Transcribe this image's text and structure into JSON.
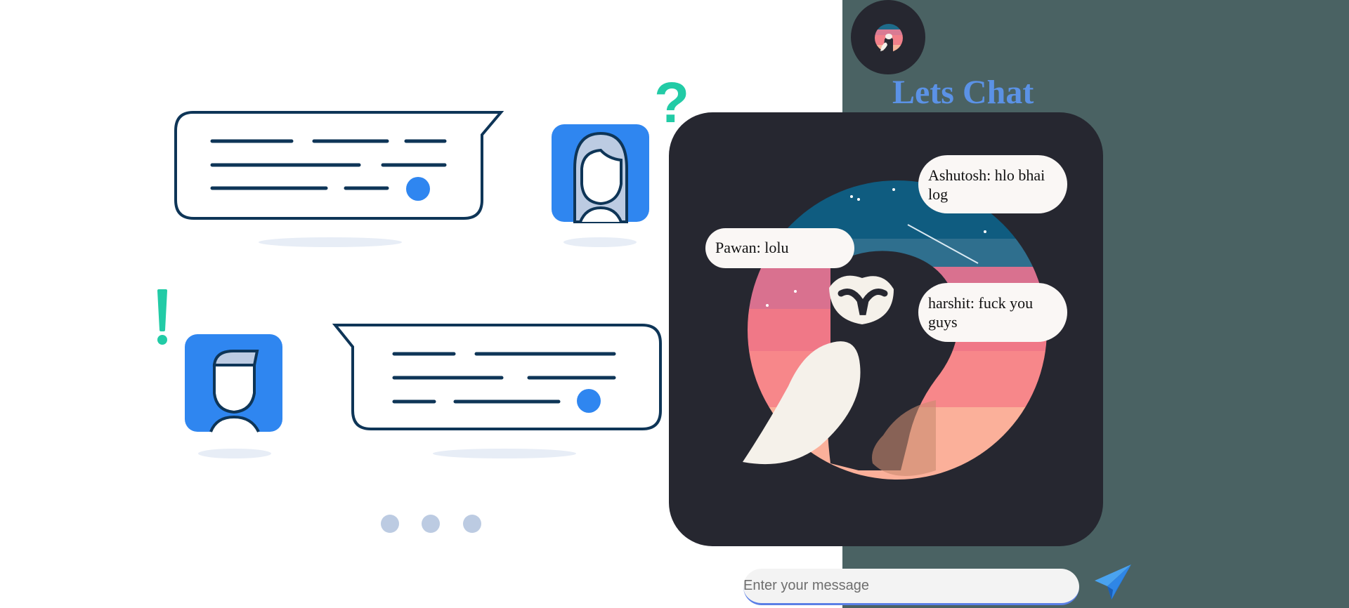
{
  "header": {
    "title": "Lets Chat",
    "logo_icon": "owl-logo-icon"
  },
  "messages": [
    {
      "sender": "Ashutosh",
      "text": "Ashutosh: hlo bhai log"
    },
    {
      "sender": "Pawan",
      "text": "Pawan: lolu"
    },
    {
      "sender": "harshit",
      "text": "harshit: fuck you guys"
    }
  ],
  "composer": {
    "placeholder": "Enter your message",
    "send_icon": "send-icon"
  },
  "colors": {
    "panel_bg": "#4a6263",
    "chat_bg": "#262730",
    "title": "#5b92e6",
    "bubble": "#faf7f5",
    "illustration_blue": "#2f86f0",
    "illustration_teal": "#22cba6",
    "illustration_line": "#0e3557"
  }
}
